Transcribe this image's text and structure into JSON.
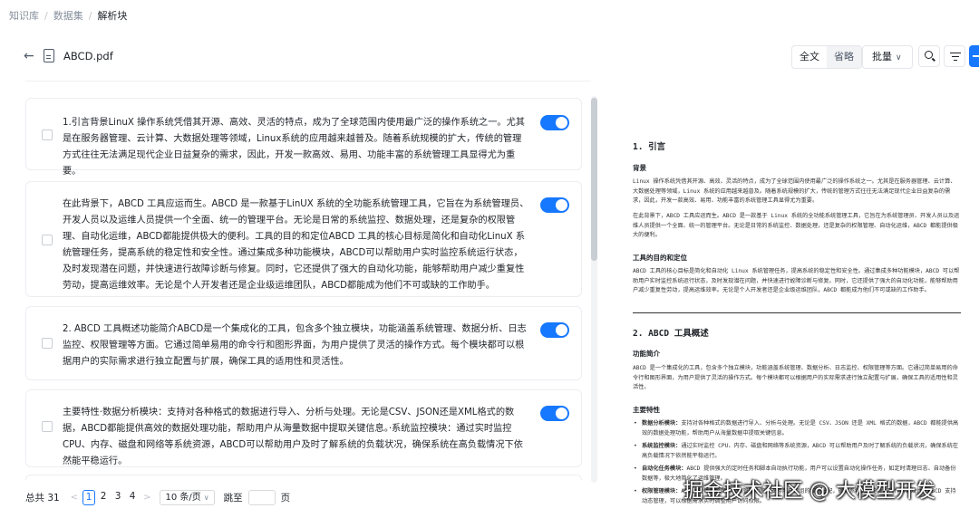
{
  "breadcrumb": {
    "items": [
      "知识库",
      "数据集",
      "解析块"
    ],
    "separator": "/"
  },
  "header": {
    "back_icon": "arrow-left-icon",
    "file_icon": "file-icon",
    "file_name": "ABCD.pdf",
    "view_full": "全文",
    "view_omit": "省略",
    "bulk_label": "批量",
    "search_icon": "search-icon",
    "filter_icon": "filter-icon"
  },
  "chunks": [
    {
      "text": "1.引言背景LinuX 操作系统凭借其开源、高效、灵活的特点，成为了全球范围内使用最广泛的操作系统之一。尤其是在服务器管理、云计算、大数据处理等领域，Linux系统的应用越来越普及。随着系统规模的扩大，传统的管理方式往往无法满足现代企业日益复杂的需求，因此，开发一款高效、易用、功能丰富的系统管理工具显得尤为重要。",
      "enabled": true
    },
    {
      "text": "在此背景下，ABCD 工具应运而生。ABCD 是一款基于LinUX 系统的全功能系统管理工具，它旨在为系统管理员、开发人员以及运维人员提供一个全面、统一的管理平台。无论是日常的系统监控、数据处理，还是复杂的权限管理、自动化运维，ABCD都能提供极大的便利。工具的目的和定位ABCD 工具的核心目标是简化和自动化LinuX 系统管理任务，提高系统的稳定性和安全性。通过集成多种功能模块，ABCD可以帮助用户实时监控系统运行状态，及时发现潜在问题，并快速进行故障诊断与修复。同时，它还提供了强大的自动化功能，能够帮助用户减少重复性劳动，提高运维效率。无论是个人开发者还是企业级运维团队，ABCD都能成为他们不可或缺的工作助手。",
      "enabled": true
    },
    {
      "text": "2. ABCD 工具概述功能简介ABCD是一个集成化的工具，包含多个独立模块，功能涵盖系统管理、数据分析、日志监控、权限管理等方面。它通过简单易用的命令行和图形界面，为用户提供了灵活的操作方式。每个模块都可以根据用户的实际需求进行独立配置与扩展，确保工具的适用性和灵活性。",
      "enabled": true
    },
    {
      "text": "主要特性·数据分析模块：支持对各种格式的数据进行导入、分析与处理。无论是CSV、JSON还是XML格式的数据，ABCD都能提供高效的数据处理功能，帮助用户从海量数据中提取关键信息。·系统监控模块：通过实时监控CPU、内存、磁盘和网络等系统资源，ABCD可以帮助用户及时了解系统的负载状况，确保系统在高负载情况下依然能平稳运行。",
      "enabled": true
    }
  ],
  "pagination": {
    "total": "总共 31",
    "pages": [
      "1",
      "2",
      "3",
      "4"
    ],
    "current": "1",
    "page_size": "10 条/页",
    "jump_label": "跳至",
    "page_suffix": "页"
  },
  "preview": {
    "s1_title": "1. 引言",
    "s1_bg_title": "背景",
    "s1_bg_p1": "Linux 操作系统凭借其开源、高效、灵活的特点，成为了全球范围内使用最广泛的操作系统之一。尤其是在服务器管理、云计算、大数据处理等领域，Linux 系统的应用越来越普及。随着系统规模的扩大，传统的管理方式往往无法满足现代企业日益复杂的需求，因此，开发一款高效、易用、功能丰富的系统管理工具显得尤为重要。",
    "s1_bg_p2": "在此背景下，ABCD 工具应运而生。ABCD 是一款基于 Linux 系统的全功能系统管理工具，它旨在为系统管理员、开发人员以及运维人员提供一个全面、统一的管理平台。无论是日常的系统监控、数据处理，还是复杂的权限管理、自动化运维，ABCD 都能提供极大的便利。",
    "s1_goal_title": "工具的目的和定位",
    "s1_goal_p": "ABCD 工具的核心目标是简化和自动化 Linux 系统管理任务，提高系统的稳定性和安全性。通过集成多种功能模块，ABCD 可以帮助用户实时监控系统运行状态，及时发现潜在问题，并快速进行故障诊断与修复。同时，它还提供了强大的自动化功能，能够帮助用户减少重复性劳动，提高运维效率。无论是个人开发者还是企业级运维团队，ABCD 都能成为他们不可或缺的工作助手。",
    "s2_title": "2. ABCD 工具概述",
    "s2_func_title": "功能简介",
    "s2_func_p": "ABCD 是一个集成化的工具，包含多个独立模块，功能涵盖系统管理、数据分析、日志监控、权限管理等方面。它通过简单易用的命令行和图形界面，为用户提供了灵活的操作方式。每个模块都可以根据用户的实际需求进行独立配置与扩展，确保工具的适用性和灵活性。",
    "s2_feat_title": "主要特性",
    "bullets": [
      {
        "label": "数据分析模块：",
        "text": "支持对各种格式的数据进行导入、分析与处理。无论是 CSV、JSON 还是 XML 格式的数据，ABCD 都能提供高效的数据处理功能，帮助用户从海量数据中提取关键信息。"
      },
      {
        "label": "系统监控模块：",
        "text": "通过实时监控 CPU、内存、磁盘和网络等系统资源，ABCD 可以帮助用户及时了解系统的负载状况，确保系统在高负载情况下依然能平稳运行。"
      },
      {
        "label": "自动化任务模块：",
        "text": "ABCD 提供强大的定时任务和脚本自动执行功能，用户可以设置自动化操作任务，如定时清理日志、自动备份数据等，极大地简化了运维管理。"
      },
      {
        "label": "权限管理模块：",
        "text": "ABCD 提供细粒度的权限管理功能，支持用户和组的权限分配，确保系统的安全性和操作的合规性。ABCD 支持动态管理，可以根据需求实时调整用户访问权限。"
      }
    ]
  },
  "watermark": "掘金技术社区 @ 大模型开发",
  "colors": {
    "accent": "#1677ff",
    "border": "#eceef2",
    "muted": "#86909c"
  }
}
